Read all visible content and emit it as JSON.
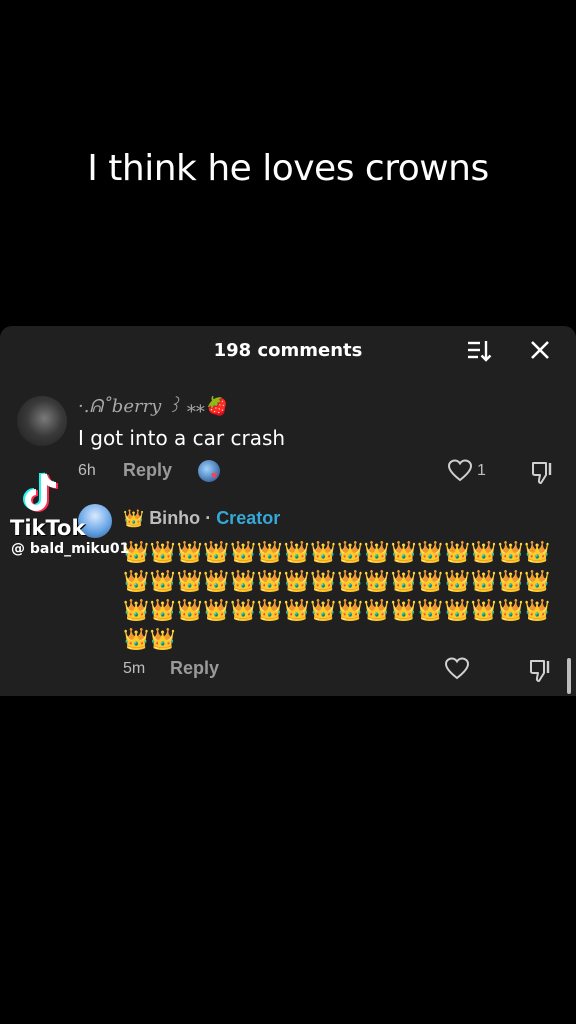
{
  "caption": "I think he loves crowns",
  "comments_panel": {
    "title": "198 comments",
    "sort_icon": "sort-icon",
    "close_icon": "close-icon",
    "comment_1": {
      "username": "·.ᕱ˚berry ꒱ ⁎⁎🍓",
      "text": "I got into a car crash",
      "time": "6h",
      "reply_label": "Reply",
      "like_count": "1"
    },
    "comment_2": {
      "crown_badge": "👑",
      "username": "Binho",
      "separator": " · ",
      "creator_label": "Creator",
      "text": "👑👑👑👑👑👑👑👑👑👑👑👑👑👑👑👑👑👑👑👑👑👑👑👑👑👑👑👑👑👑👑👑👑👑👑👑👑👑👑👑👑👑👑👑👑👑👑👑👑👑",
      "time": "5m",
      "reply_label": "Reply"
    }
  },
  "watermark": {
    "brand": "TikTok",
    "handle": "@ bald_miku01"
  },
  "colors": {
    "background": "#000000",
    "panel": "#202020",
    "creator_accent": "#37a7d8",
    "heart_accent": "#ff3b5c"
  }
}
